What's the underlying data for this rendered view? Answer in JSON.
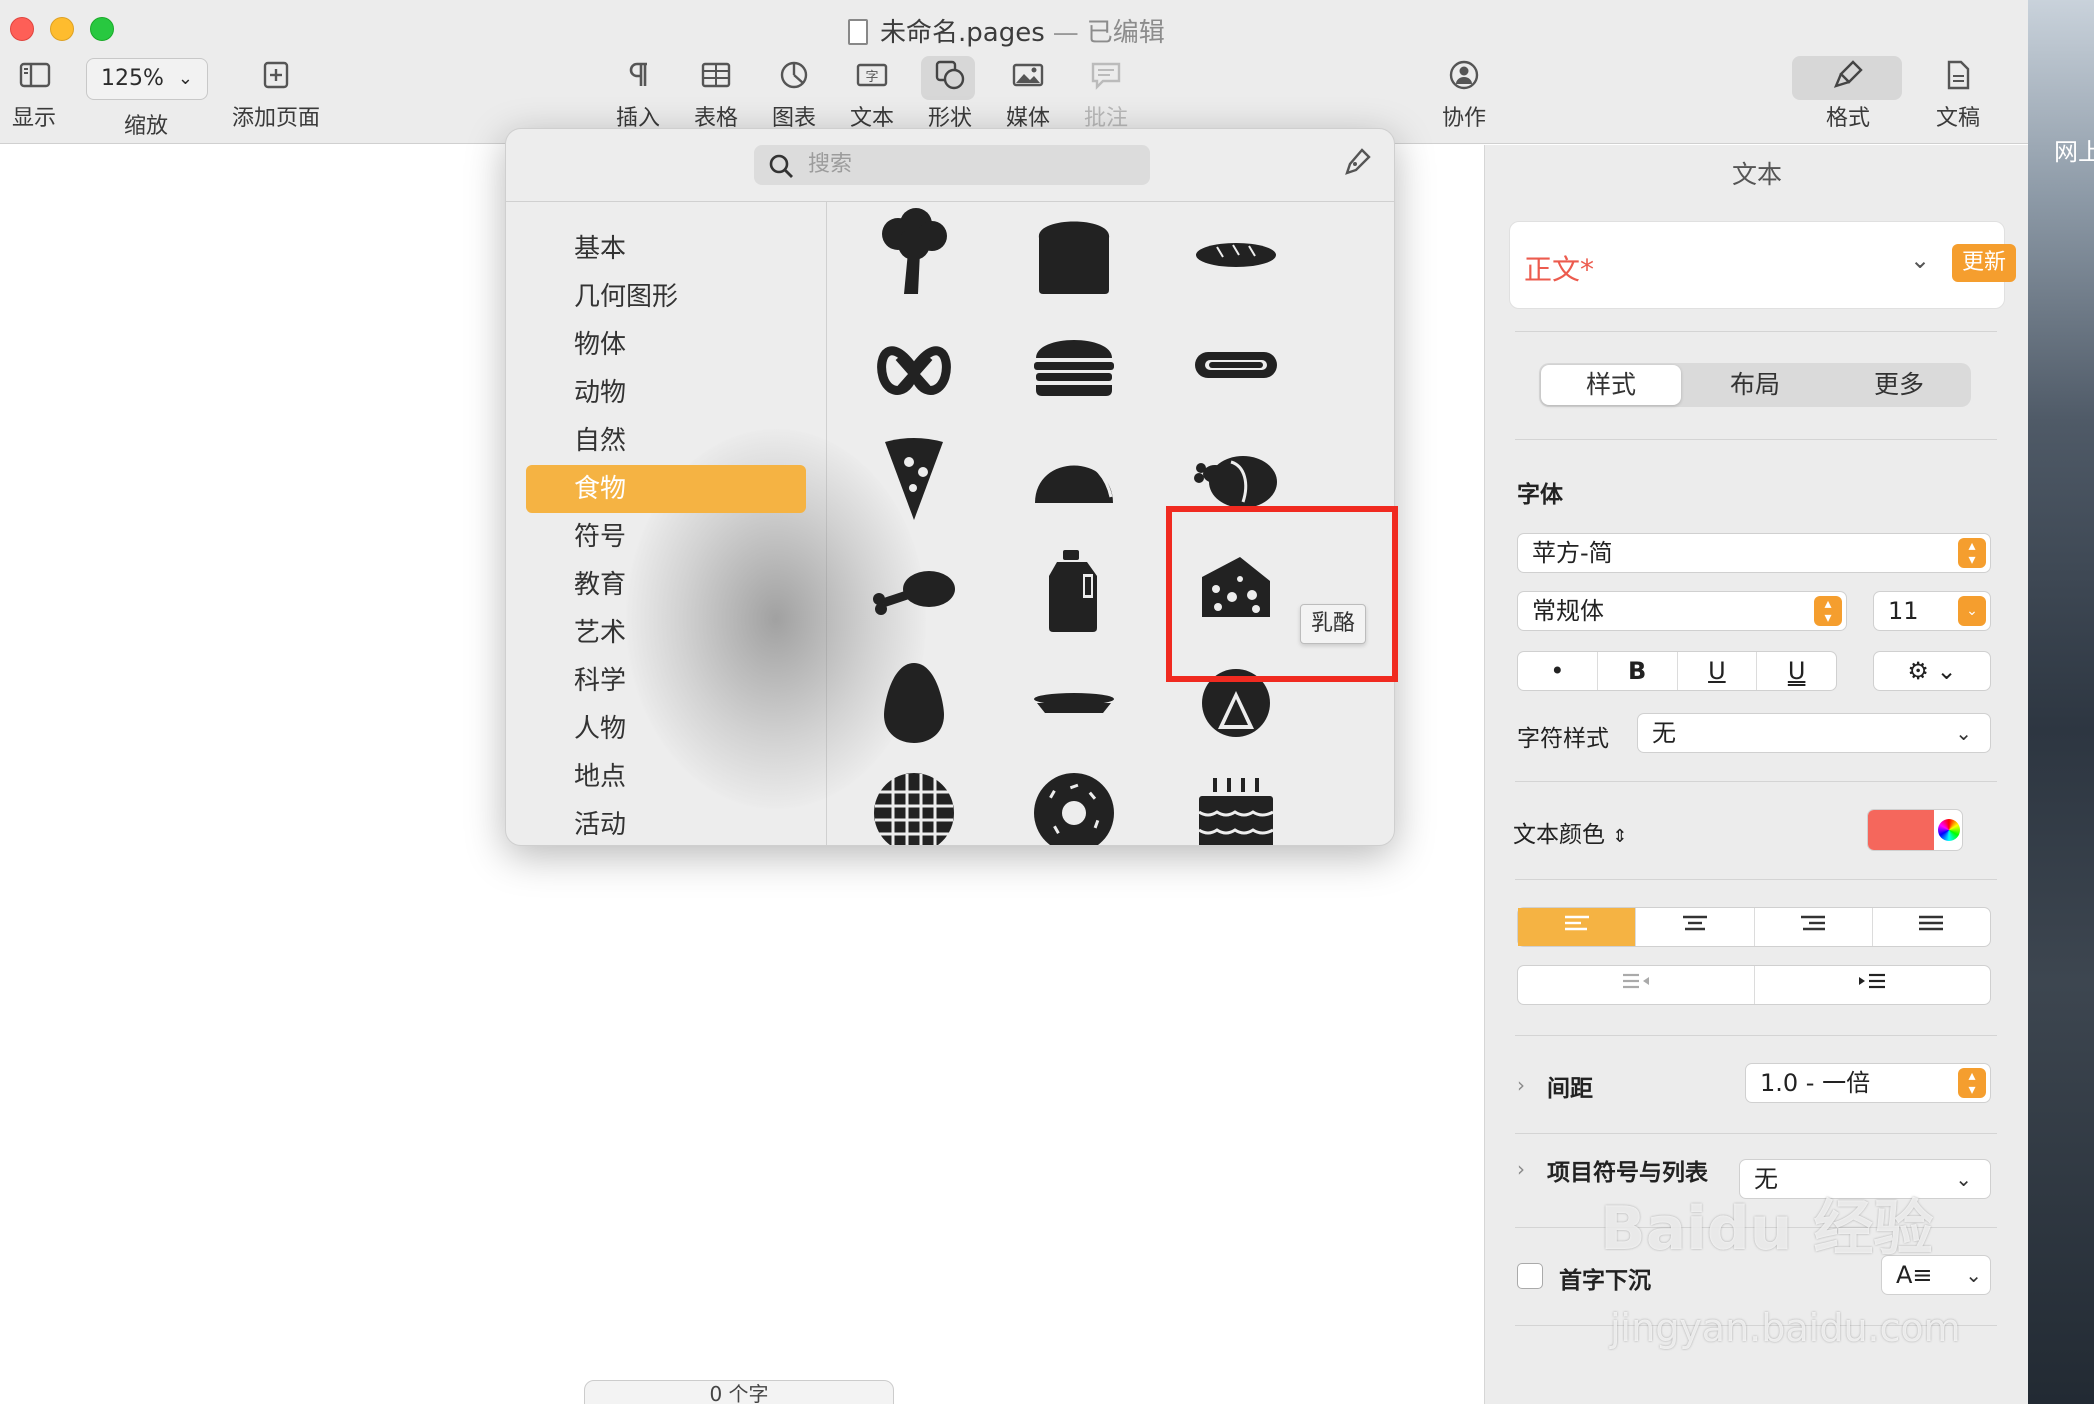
{
  "window": {
    "title": "未命名.pages",
    "title_sep": "—",
    "status": "已编辑"
  },
  "toolbar": {
    "view_label": "显示",
    "zoom_value": "125%",
    "zoom_label": "缩放",
    "add_page_label": "添加页面",
    "insert_label": "插入",
    "table_label": "表格",
    "chart_label": "图表",
    "text_label": "文本",
    "shape_label": "形状",
    "media_label": "媒体",
    "comment_label": "批注",
    "collaborate_label": "协作",
    "format_label": "格式",
    "document_label": "文稿"
  },
  "shape_popover": {
    "search_placeholder": "搜索",
    "categories": [
      "基本",
      "几何图形",
      "物体",
      "动物",
      "自然",
      "食物",
      "符号",
      "教育",
      "艺术",
      "科学",
      "人物",
      "地点",
      "活动"
    ],
    "selected_category": "食物",
    "shapes": [
      "broccoli-icon",
      "bread-icon",
      "baguette-icon",
      "pretzel-icon",
      "burger-icon",
      "hotdog-icon",
      "pizza-icon",
      "taco-icon",
      "roast-chicken-icon",
      "drumstick-icon",
      "milk-jug-icon",
      "cheese-icon",
      "egg-icon",
      "pie-icon",
      "pie-slice-icon",
      "waffle-icon",
      "donut-icon",
      "cake-icon"
    ],
    "tooltip": "乳酪",
    "highlight_color": "#f02a20"
  },
  "inspector": {
    "tab_title": "文本",
    "paragraph_style": "正文*",
    "update_label": "更新",
    "segments": [
      "样式",
      "布局",
      "更多"
    ],
    "active_segment": "样式",
    "font_section": "字体",
    "font_family": "苹方-简",
    "font_weight": "常规体",
    "font_size": "11",
    "style_buttons": [
      "•",
      "B",
      "U",
      "U"
    ],
    "char_style_label": "字符样式",
    "char_style_value": "无",
    "text_color_label": "文本颜色",
    "text_color": "#f5675c",
    "spacing_label": "间距",
    "spacing_value": "1.0 - 一倍",
    "bullets_label": "项目符号与列表",
    "bullets_value": "无",
    "dropcap_label": "首字下沉"
  },
  "canvas": {
    "bottom_pill": "0 个字"
  },
  "desktop": {
    "label": "网上"
  },
  "watermark": {
    "text": "Baidu 经验",
    "sub": "jingyan.baidu.com"
  },
  "colors": {
    "accent": "#f5b343",
    "update_button": "#f59e2e",
    "paragraph_style_text": "#ec5b4e"
  }
}
